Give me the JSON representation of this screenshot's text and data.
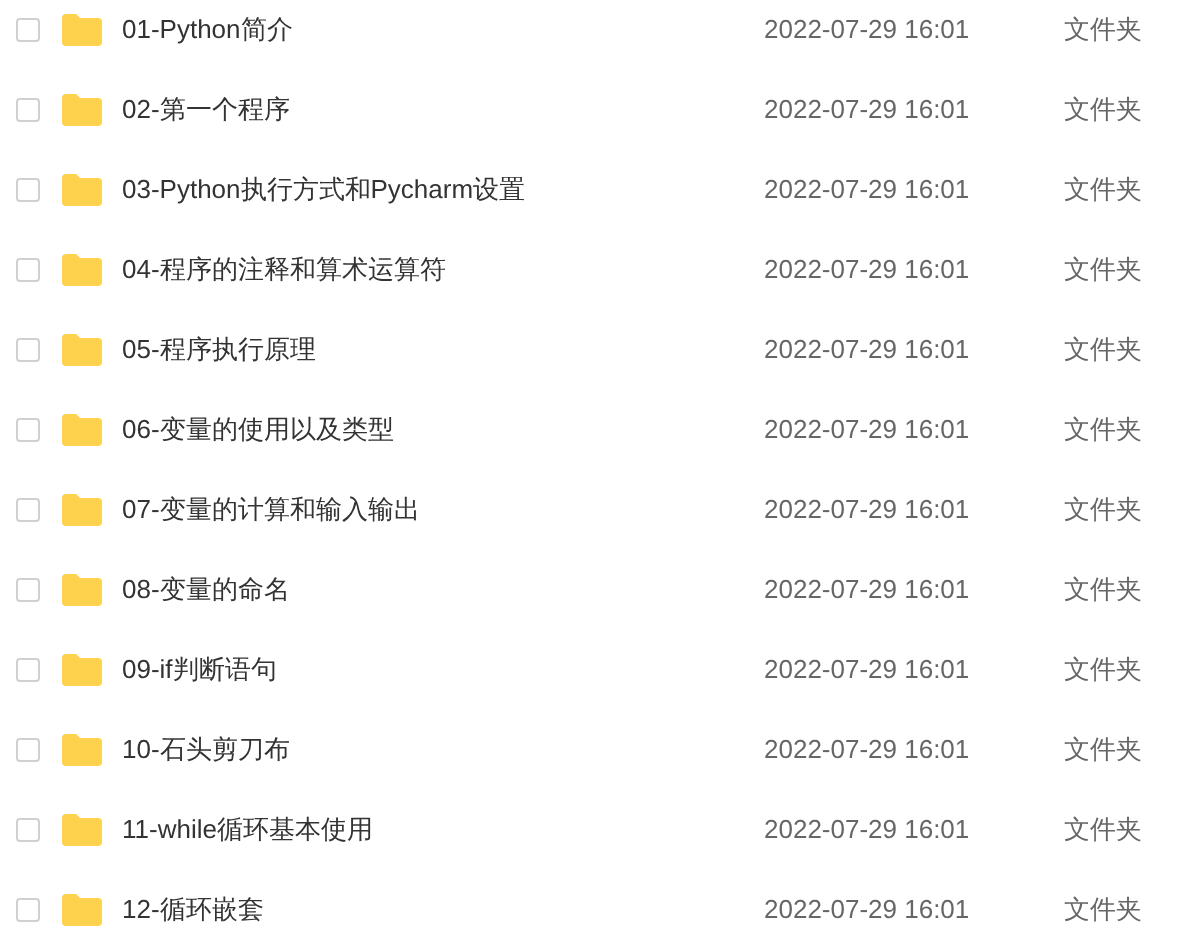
{
  "files": [
    {
      "name": "01-Python简介",
      "modified": "2022-07-29 16:01",
      "type": "文件夹",
      "checked": false
    },
    {
      "name": "02-第一个程序",
      "modified": "2022-07-29 16:01",
      "type": "文件夹",
      "checked": false
    },
    {
      "name": "03-Python执行方式和Pycharm设置",
      "modified": "2022-07-29 16:01",
      "type": "文件夹",
      "checked": false
    },
    {
      "name": "04-程序的注释和算术运算符",
      "modified": "2022-07-29 16:01",
      "type": "文件夹",
      "checked": false
    },
    {
      "name": "05-程序执行原理",
      "modified": "2022-07-29 16:01",
      "type": "文件夹",
      "checked": false
    },
    {
      "name": "06-变量的使用以及类型",
      "modified": "2022-07-29 16:01",
      "type": "文件夹",
      "checked": false
    },
    {
      "name": "07-变量的计算和输入输出",
      "modified": "2022-07-29 16:01",
      "type": "文件夹",
      "checked": false
    },
    {
      "name": "08-变量的命名",
      "modified": "2022-07-29 16:01",
      "type": "文件夹",
      "checked": false
    },
    {
      "name": "09-if判断语句",
      "modified": "2022-07-29 16:01",
      "type": "文件夹",
      "checked": false
    },
    {
      "name": "10-石头剪刀布",
      "modified": "2022-07-29 16:01",
      "type": "文件夹",
      "checked": false
    },
    {
      "name": "11-while循环基本使用",
      "modified": "2022-07-29 16:01",
      "type": "文件夹",
      "checked": false
    },
    {
      "name": "12-循环嵌套",
      "modified": "2022-07-29 16:01",
      "type": "文件夹",
      "checked": false
    }
  ]
}
